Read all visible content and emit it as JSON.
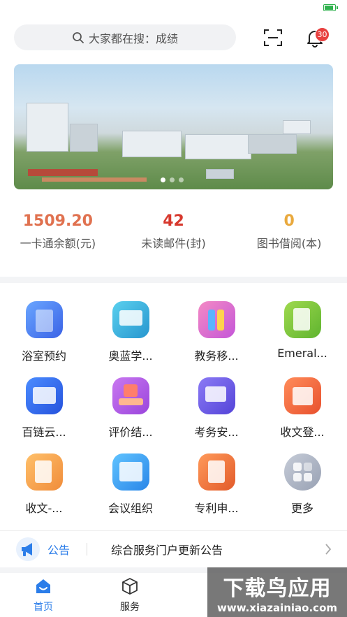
{
  "status": {
    "battery_level": 0.8,
    "battery_color": "#2fb14d"
  },
  "search": {
    "placeholder": "大家都在搜：成绩"
  },
  "header": {
    "badge_count": "30"
  },
  "banner": {
    "slide_count": 3,
    "active_slide": 1
  },
  "stats": [
    {
      "value": "1509.20",
      "label": "一卡通余额(元)",
      "color": "#e0714f"
    },
    {
      "value": "42",
      "label": "未读邮件(封)",
      "color": "#d7382d"
    },
    {
      "value": "0",
      "label": "图书借阅(本)",
      "color": "#e9a93d"
    }
  ],
  "apps": [
    {
      "label": "浴室预约",
      "icon": "building-icon",
      "color": "#4b7ff0"
    },
    {
      "label": "奥蓝学...",
      "icon": "monitor-icon",
      "color": "#2fb1d6"
    },
    {
      "label": "教务移...",
      "icon": "books-icon",
      "color": "#e46bb0"
    },
    {
      "label": "Emeral...",
      "icon": "document-search-icon",
      "color": "#7dc33b"
    },
    {
      "label": "百链云...",
      "icon": "open-book-icon",
      "color": "#2f6be6"
    },
    {
      "label": "评价结...",
      "icon": "hand-card-icon",
      "color": "#b45be6"
    },
    {
      "label": "考务安...",
      "icon": "schedule-clock-icon",
      "color": "#6b5be8"
    },
    {
      "label": "收文登...",
      "icon": "inbox-register-icon",
      "color": "#f06a3a"
    },
    {
      "label": "收文-...",
      "icon": "document-edit-icon",
      "color": "#f2a144"
    },
    {
      "label": "会议组织",
      "icon": "meeting-board-icon",
      "color": "#3aa1ef"
    },
    {
      "label": "专利申...",
      "icon": "patent-icon",
      "color": "#ef6c3a"
    },
    {
      "label": "更多",
      "icon": "more-grid-icon",
      "color": "#aeb5c4"
    }
  ],
  "notice": {
    "tag": "公告",
    "text": "综合服务门户更新公告"
  },
  "tabs": [
    {
      "label": "首页",
      "icon": "home-icon",
      "active": true
    },
    {
      "label": "服务",
      "icon": "cube-icon",
      "active": false
    }
  ],
  "watermark": {
    "title": "下载鸟应用",
    "url": "www.xiazainiao.com"
  },
  "colors": {
    "accent": "#2b7de9",
    "badge": "#e8403f"
  }
}
